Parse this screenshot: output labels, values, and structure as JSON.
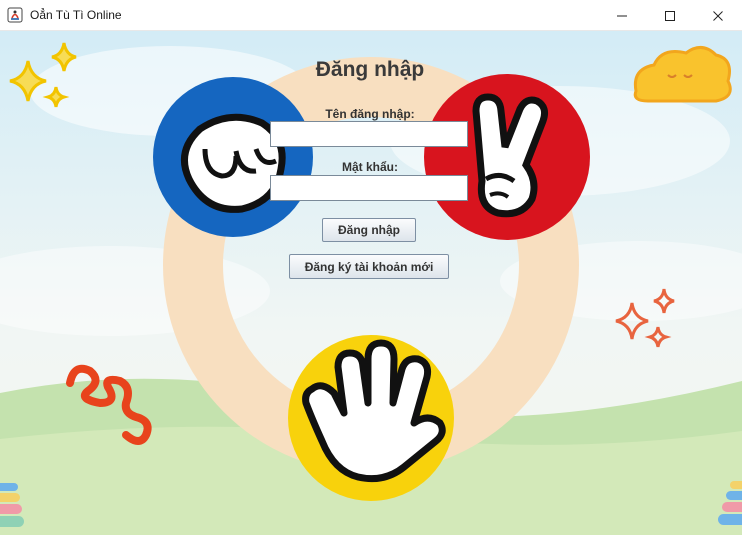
{
  "window": {
    "title": "Oẳn Tù Tì Online",
    "minimize_icon": "minimize-icon",
    "maximize_icon": "maximize-icon",
    "close_icon": "close-icon"
  },
  "login": {
    "heading": "Đăng nhập",
    "username_label": "Tên đăng nhập:",
    "username_value": "",
    "password_label": "Mật khẩu:",
    "password_value": "",
    "login_button": "Đăng nhập",
    "register_button": "Đăng ký tài khoản mới"
  },
  "decorations": {
    "rock_color": "#1566c0",
    "scissors_color": "#d8141e",
    "paper_color": "#f8d20c",
    "ring_color": "#f8dfc0",
    "sparkle_left_color": "#f5d33b",
    "sparkle_right_color": "#e8643f",
    "squiggle_color": "#e8431c",
    "cloud_color": "#f9c32d"
  }
}
